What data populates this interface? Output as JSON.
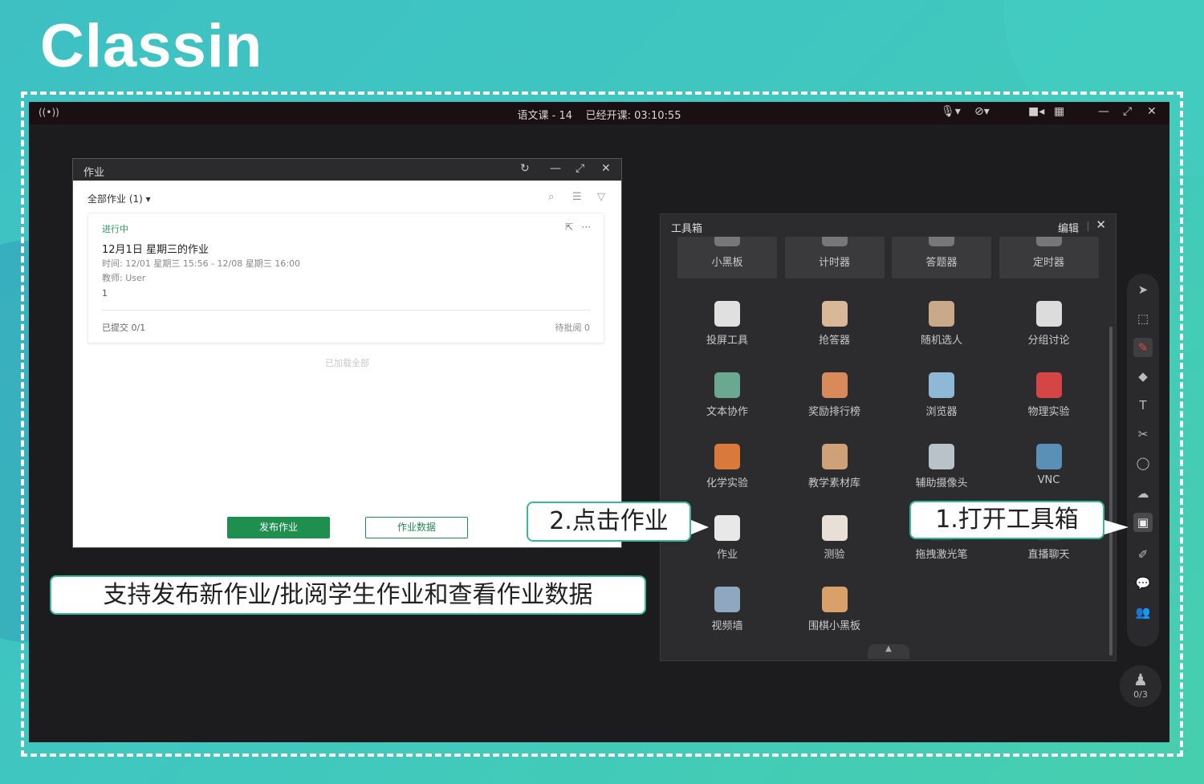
{
  "brand": {
    "logo_text": "Classin"
  },
  "titlebar": {
    "signal_icon": "((•))",
    "class_title": "语文课 - 14",
    "elapsed": "已经开课: 03:10:55",
    "icons": [
      "mic-off-icon",
      "camera-off-icon",
      "video-icon",
      "grid-icon",
      "minimize-icon",
      "restore-icon",
      "close-icon"
    ]
  },
  "homework": {
    "window_title": "作业",
    "filter_label": "全部作业 (1)",
    "card": {
      "status": "进行中",
      "title": "12月1日 星期三的作业",
      "time": "时间: 12/01 星期三 15:56 - 12/08 星期三 16:00",
      "teacher": "教师: User",
      "count": "1",
      "submitted": "已提交 0/1",
      "pending": "待批阅 0"
    },
    "loaded_all": "已加载全部",
    "publish_button": "发布作业",
    "data_button": "作业数据"
  },
  "toolbox": {
    "title": "工具箱",
    "edit_label": "编辑",
    "top_row": [
      "小黑板",
      "计时器",
      "答题器",
      "定时器"
    ],
    "tools": [
      {
        "label": "投屏工具",
        "color": "#e0e0e0"
      },
      {
        "label": "抢答器",
        "color": "#d9b89a"
      },
      {
        "label": "随机选人",
        "color": "#c9a989"
      },
      {
        "label": "分组讨论",
        "color": "#dcdcdc"
      },
      {
        "label": "文本协作",
        "color": "#6aa891"
      },
      {
        "label": "奖励排行榜",
        "color": "#d98a5a"
      },
      {
        "label": "浏览器",
        "color": "#8fb8d6"
      },
      {
        "label": "物理实验",
        "color": "#d64545"
      },
      {
        "label": "化学实验",
        "color": "#d97a3a"
      },
      {
        "label": "教学素材库",
        "color": "#cfa178"
      },
      {
        "label": "辅助摄像头",
        "color": "#b9c2c8"
      },
      {
        "label": "VNC",
        "color": "#5a8fb8"
      },
      {
        "label": "作业",
        "color": "#e8e8e8"
      },
      {
        "label": "测验",
        "color": "#e8e0d6"
      },
      {
        "label": "拖拽激光笔",
        "color": "#3a3a3c"
      },
      {
        "label": "直播聊天",
        "color": "#3a3a3c"
      },
      {
        "label": "视频墙",
        "color": "#8fa8c0"
      },
      {
        "label": "围棋小黑板",
        "color": "#d9a06a"
      }
    ]
  },
  "sidebar_icons": [
    "pointer-icon",
    "select-icon",
    "pen-icon",
    "eraser-icon",
    "text-icon",
    "scissors-icon",
    "shape-icon",
    "cloud-icon",
    "toolbox-icon",
    "edit-icon",
    "chat-icon",
    "users-icon"
  ],
  "student_count": "0/3",
  "callouts": {
    "step2": "2.点击作业",
    "step1": "1.打开工具箱",
    "summary": "支持发布新作业/批阅学生作业和查看作业数据"
  }
}
